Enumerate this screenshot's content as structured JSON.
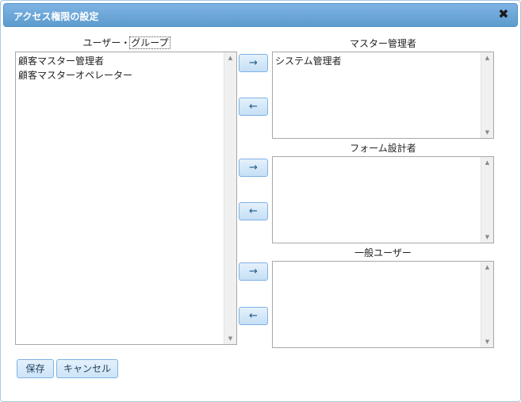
{
  "dialog": {
    "title": "アクセス権限の設定",
    "close_symbol": "✖"
  },
  "user_group": {
    "label_prefix": "ユーザー・",
    "label_link": "グループ",
    "items": [
      "顧客マスター管理者",
      "顧客マスターオペレーター"
    ]
  },
  "roles": [
    {
      "label": "マスター管理者",
      "items": [
        "システム管理者"
      ]
    },
    {
      "label": "フォーム設計者",
      "items": []
    },
    {
      "label": "一般ユーザー",
      "items": []
    }
  ],
  "arrows": {
    "add": "→",
    "remove": "←"
  },
  "scroll": {
    "up": "▲",
    "down": "▼"
  },
  "buttons": {
    "save": "保存",
    "cancel": "キャンセル"
  }
}
